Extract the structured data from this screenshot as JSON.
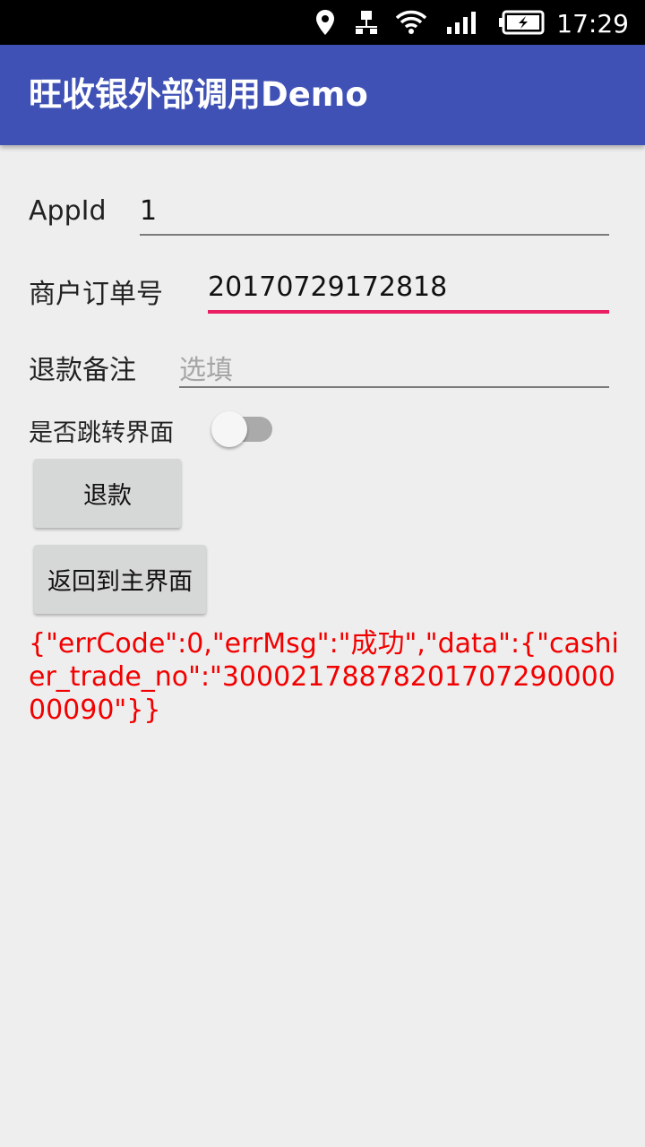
{
  "status_bar": {
    "time": "17:29",
    "icons": [
      "location-icon",
      "network-icon",
      "wifi-icon",
      "signal-icon",
      "battery-icon"
    ]
  },
  "app_bar": {
    "title": "旺收银外部调用Demo",
    "color": "#3f51b5"
  },
  "form": {
    "app_id": {
      "label": "AppId",
      "value": "1"
    },
    "order_no": {
      "label": "商户订单号",
      "value": "20170729172818"
    },
    "refund_note": {
      "label": "退款备注",
      "value": "",
      "placeholder": "选填"
    },
    "jump_switch": {
      "label": "是否跳转界面",
      "checked": false
    }
  },
  "buttons": {
    "refund": "退款",
    "back_to_main": "返回到主界面"
  },
  "result_text": "{\"errCode\":0,\"errMsg\":\"成功\",\"data\":{\"cashier_trade_no\":\"3000217887820170729000000090\"}}",
  "colors": {
    "accent": "#e91e63",
    "result_text": "#f20000",
    "background": "#eeeeee"
  }
}
